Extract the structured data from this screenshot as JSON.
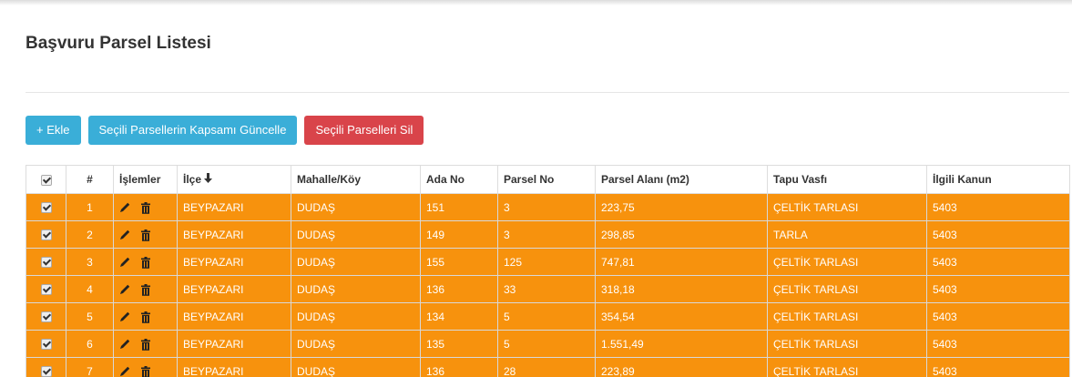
{
  "panel": {
    "title": "Başvuru Parsel Listesi"
  },
  "toolbar": {
    "add_label": "+ Ekle",
    "update_label": "Seçili Parsellerin Kapsamı Güncelle",
    "delete_label": "Seçili Parselleri Sil"
  },
  "colors": {
    "row_highlight": "#f7920d",
    "info_button": "#3aaed8",
    "danger_button": "#d9444a"
  },
  "table": {
    "headers": {
      "index": "#",
      "actions": "İşlemler",
      "district": "İlçe",
      "neighborhood": "Mahalle/Köy",
      "block_no": "Ada No",
      "parcel_no": "Parsel No",
      "parcel_area": "Parsel Alanı (m2)",
      "deed_quality": "Tapu Vasfı",
      "law": "İlgili Kanun"
    },
    "sort_icon": "arrow-down-icon",
    "action_icons": [
      "pencil-icon",
      "trash-icon"
    ],
    "rows": [
      {
        "checked": true,
        "index": "1",
        "district": "BEYPAZARI",
        "neighborhood": "DUDAŞ",
        "block_no": "151",
        "parcel_no": "3",
        "parcel_area": "223,75",
        "deed_quality": "ÇELTİK TARLASI",
        "law": "5403"
      },
      {
        "checked": true,
        "index": "2",
        "district": "BEYPAZARI",
        "neighborhood": "DUDAŞ",
        "block_no": "149",
        "parcel_no": "3",
        "parcel_area": "298,85",
        "deed_quality": "TARLA",
        "law": "5403"
      },
      {
        "checked": true,
        "index": "3",
        "district": "BEYPAZARI",
        "neighborhood": "DUDAŞ",
        "block_no": "155",
        "parcel_no": "125",
        "parcel_area": "747,81",
        "deed_quality": "ÇELTİK TARLASI",
        "law": "5403"
      },
      {
        "checked": true,
        "index": "4",
        "district": "BEYPAZARI",
        "neighborhood": "DUDAŞ",
        "block_no": "136",
        "parcel_no": "33",
        "parcel_area": "318,18",
        "deed_quality": "ÇELTİK TARLASI",
        "law": "5403"
      },
      {
        "checked": true,
        "index": "5",
        "district": "BEYPAZARI",
        "neighborhood": "DUDAŞ",
        "block_no": "134",
        "parcel_no": "5",
        "parcel_area": "354,54",
        "deed_quality": "ÇELTİK TARLASI",
        "law": "5403"
      },
      {
        "checked": true,
        "index": "6",
        "district": "BEYPAZARI",
        "neighborhood": "DUDAŞ",
        "block_no": "135",
        "parcel_no": "5",
        "parcel_area": "1.551,49",
        "deed_quality": "ÇELTİK TARLASI",
        "law": "5403"
      },
      {
        "checked": true,
        "index": "7",
        "district": "BEYPAZARI",
        "neighborhood": "DUDAŞ",
        "block_no": "136",
        "parcel_no": "28",
        "parcel_area": "223,89",
        "deed_quality": "ÇELTİK TARLASI",
        "law": "5403"
      }
    ]
  }
}
